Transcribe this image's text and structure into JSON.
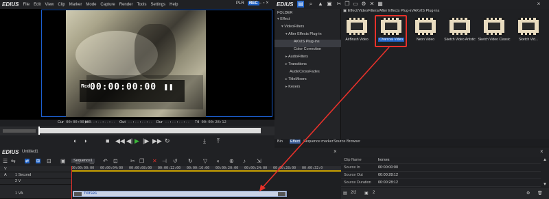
{
  "app": {
    "name": "EDIUS"
  },
  "menu": [
    "File",
    "Edit",
    "View",
    "Clip",
    "Marker",
    "Mode",
    "Capture",
    "Render",
    "Tools",
    "Settings",
    "Help"
  ],
  "player": {
    "plr_label": "PLR",
    "rec_label": "REC",
    "rec_tag": "Rcd",
    "timecode": "00:00:00:00",
    "cur_label": "Cur",
    "cur_value": "00:00:00;00",
    "in_label": "In",
    "in_value": "--:--:--:--",
    "out_label": "Out",
    "out_value": "--:--:--:--",
    "dur_label": "Dur",
    "dur_value": "--:--:--:--",
    "ttl_label": "Ttl",
    "ttl_value": "00:00:28:12"
  },
  "folder": {
    "header": "FOLDER",
    "items": [
      {
        "label": "Effect",
        "level": 0,
        "arrow": "▾"
      },
      {
        "label": "VideoFilters",
        "level": 1,
        "arrow": "▾"
      },
      {
        "label": "After Effects Plug-in",
        "level": 2,
        "arrow": "▾"
      },
      {
        "label": "AKVIS Plug-ins",
        "level": 3,
        "arrow": "",
        "selected": true
      },
      {
        "label": "Color Correction",
        "level": 2,
        "arrow": ""
      },
      {
        "label": "AudioFilters",
        "level": 1,
        "arrow": "▸"
      },
      {
        "label": "Transitions",
        "level": 1,
        "arrow": "▸"
      },
      {
        "label": "AudioCrossFades",
        "level": 1,
        "arrow": ""
      },
      {
        "label": "TitleMixers",
        "level": 1,
        "arrow": "▸"
      },
      {
        "label": "Keyers",
        "level": 1,
        "arrow": "▸"
      }
    ]
  },
  "bin": {
    "path": "Effect/VideoFilters/After Effects Plug-in/AKVIS Plug-ins",
    "clips": [
      {
        "label": "AirBrush Video"
      },
      {
        "label": "Charcoal Video",
        "selected": true
      },
      {
        "label": "Neon Video"
      },
      {
        "label": "Sketch Video Artistic"
      },
      {
        "label": "Sketch Video Classic"
      },
      {
        "label": "Sketch Vid..."
      }
    ],
    "tabs": [
      "Bin",
      "Effect",
      "Sequence marker",
      "Source Browser"
    ]
  },
  "timeline": {
    "project": "Untitled1",
    "sequence_tab": "Sequence1",
    "ruler": [
      "00:00:00:00",
      "00:00:04:00",
      "00:00:08:00",
      "00:00:12:00",
      "00:00:16:00",
      "00:00:20:00",
      "00:00:24:00",
      "00:00:28:00",
      "00:00:32:0"
    ],
    "tracks": [
      {
        "tag": "V",
        "name": ""
      },
      {
        "tag": "A",
        "name": "1 Second"
      },
      {
        "tag": "",
        "name": "2 V"
      },
      {
        "tag": "",
        "name": "1 VA"
      }
    ],
    "clip_label": "horses"
  },
  "info": {
    "rows": [
      {
        "k": "Clip Name",
        "v": "horses"
      },
      {
        "k": "Source In",
        "v": "00:00:00:00"
      },
      {
        "k": "Source Out",
        "v": "00:00:28:12"
      },
      {
        "k": "Source Duration",
        "v": "00:00:28:12"
      }
    ],
    "page": "2/2",
    "count": "2"
  },
  "colors": {
    "accent": "#1f63c9",
    "highlight": "#e8312a",
    "playhead": "#e8312a"
  }
}
